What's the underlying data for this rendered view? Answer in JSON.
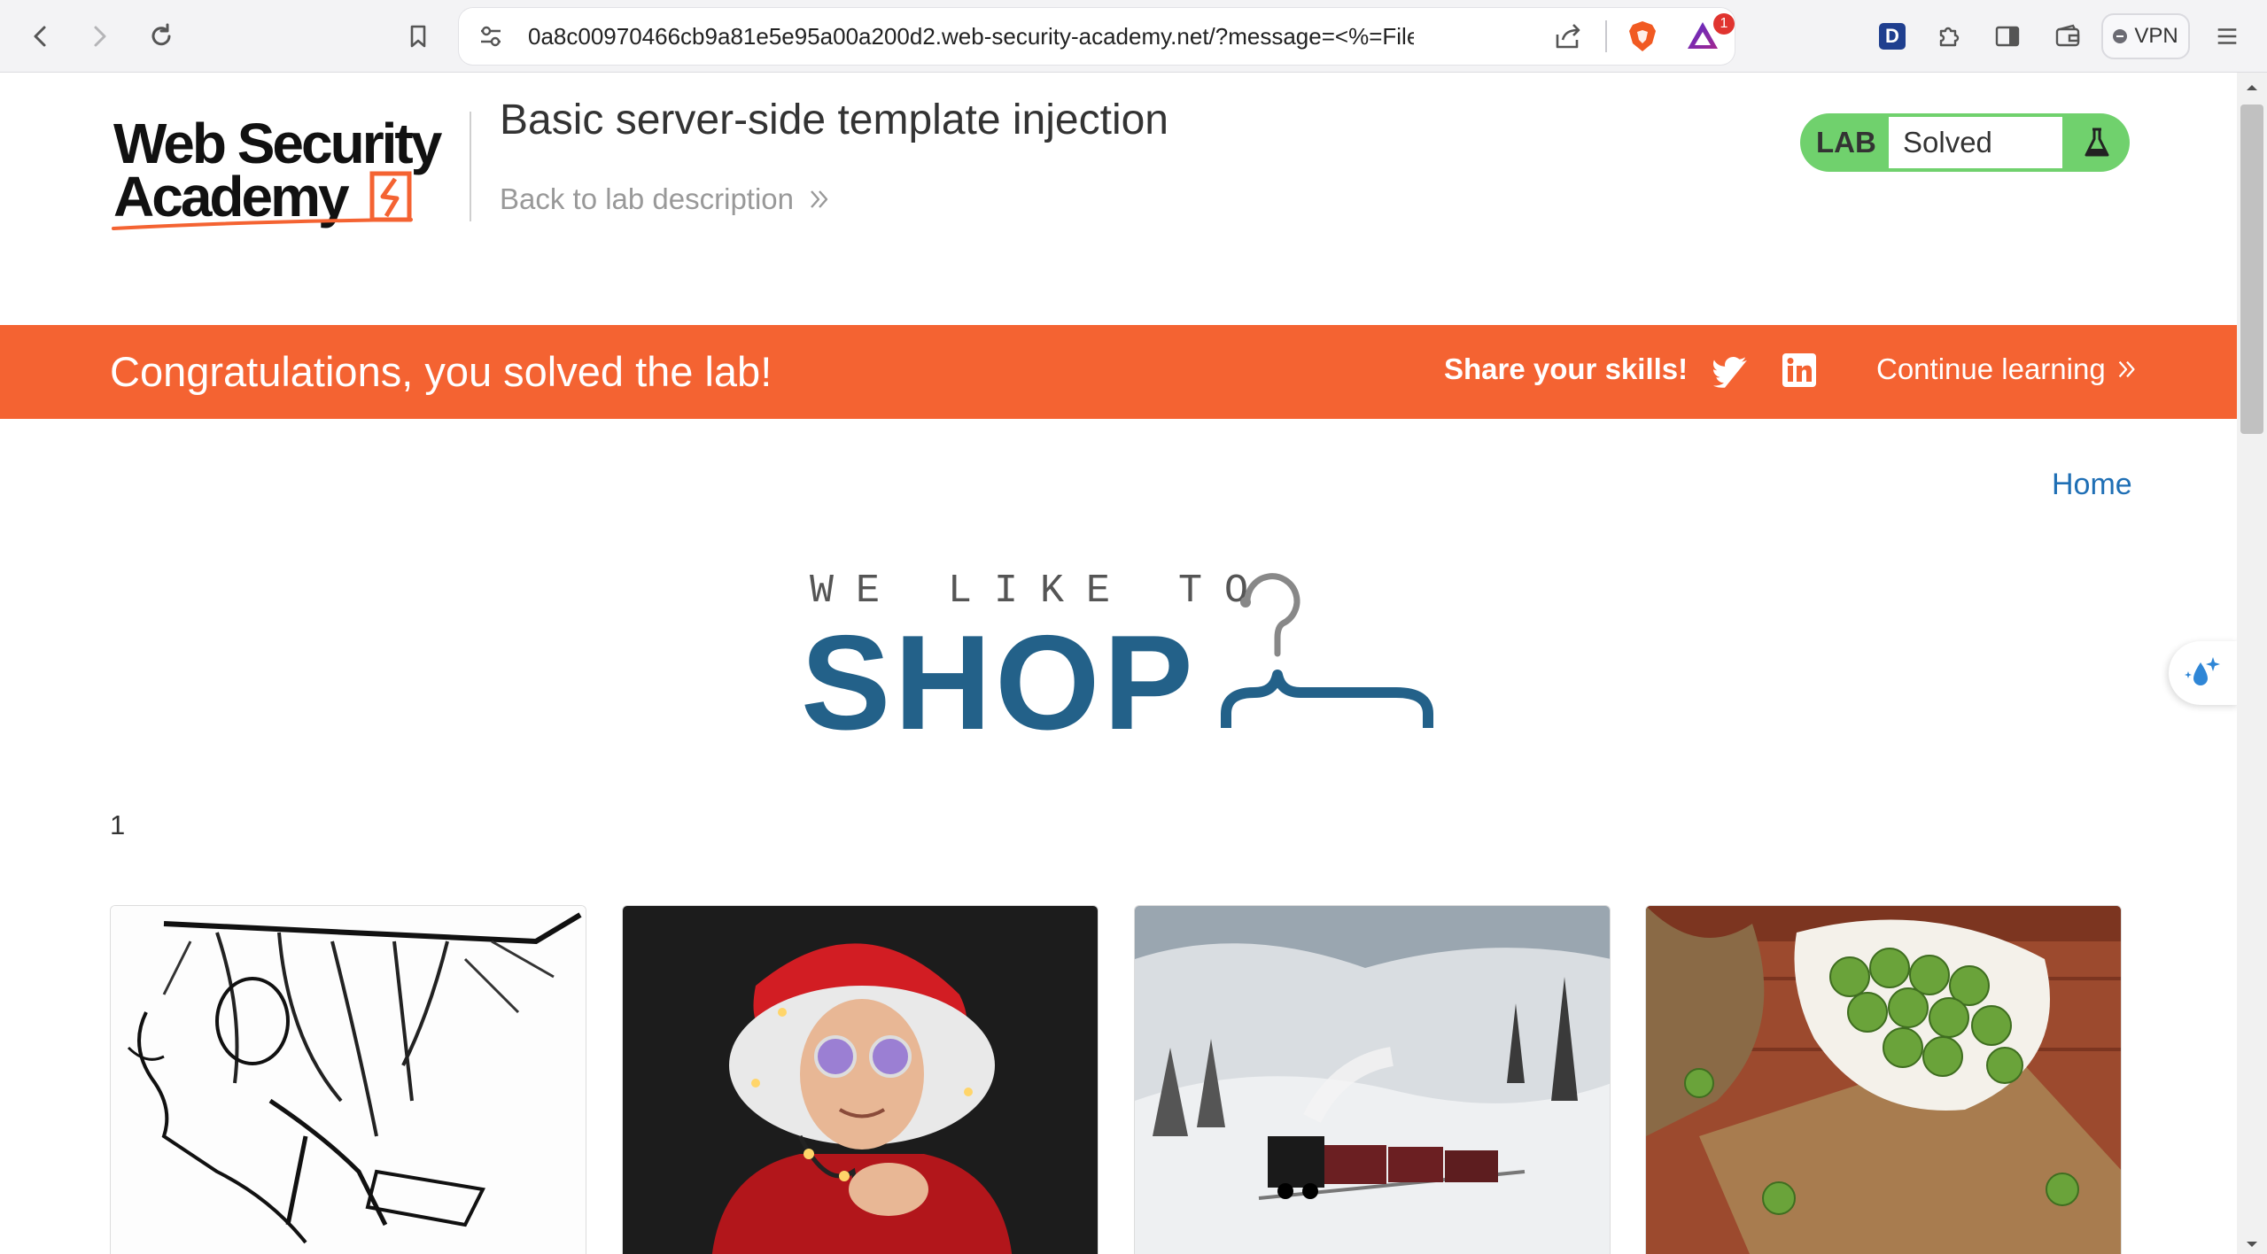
{
  "browser": {
    "url": "0a8c00970466cb9a81e5e95a00a200d2.web-security-academy.net/?message=<%=File.del...",
    "rewards_badge": "1",
    "vpn_label": "VPN",
    "icons": [
      "back-arrow-icon",
      "forward-arrow-icon",
      "reload-icon",
      "bookmark-icon",
      "tune-icon",
      "share-icon",
      "brave-shield-icon",
      "brave-rewards-icon",
      "dashlane-icon",
      "extensions-puzzle-icon",
      "sidebar-icon",
      "wallet-icon",
      "menu-icon"
    ],
    "dashlane_letter": "D"
  },
  "header": {
    "logo_text": "Web Security Academy",
    "lab_title": "Basic server-side template injection",
    "back_link": "Back to lab description",
    "lab_status": {
      "label": "LAB",
      "status": "Solved"
    }
  },
  "banner": {
    "message": "Congratulations, you solved the lab!",
    "share": "Share your skills!",
    "continue": "Continue learning"
  },
  "nav": {
    "home": "Home"
  },
  "shop_logo": {
    "tagline": "WE LIKE TO",
    "word": "SHOP"
  },
  "message_output": "1",
  "products": [
    {
      "image": "sketch-man-contraption"
    },
    {
      "image": "man-with-christmas-lights"
    },
    {
      "image": "steam-train-in-snow"
    },
    {
      "image": "brussels-sprouts-bowl"
    }
  ],
  "colors": {
    "banner": "#f46332",
    "lab_solved_green": "#70d16d",
    "shop_blue": "#236189",
    "link_blue": "#1f6fb5"
  }
}
